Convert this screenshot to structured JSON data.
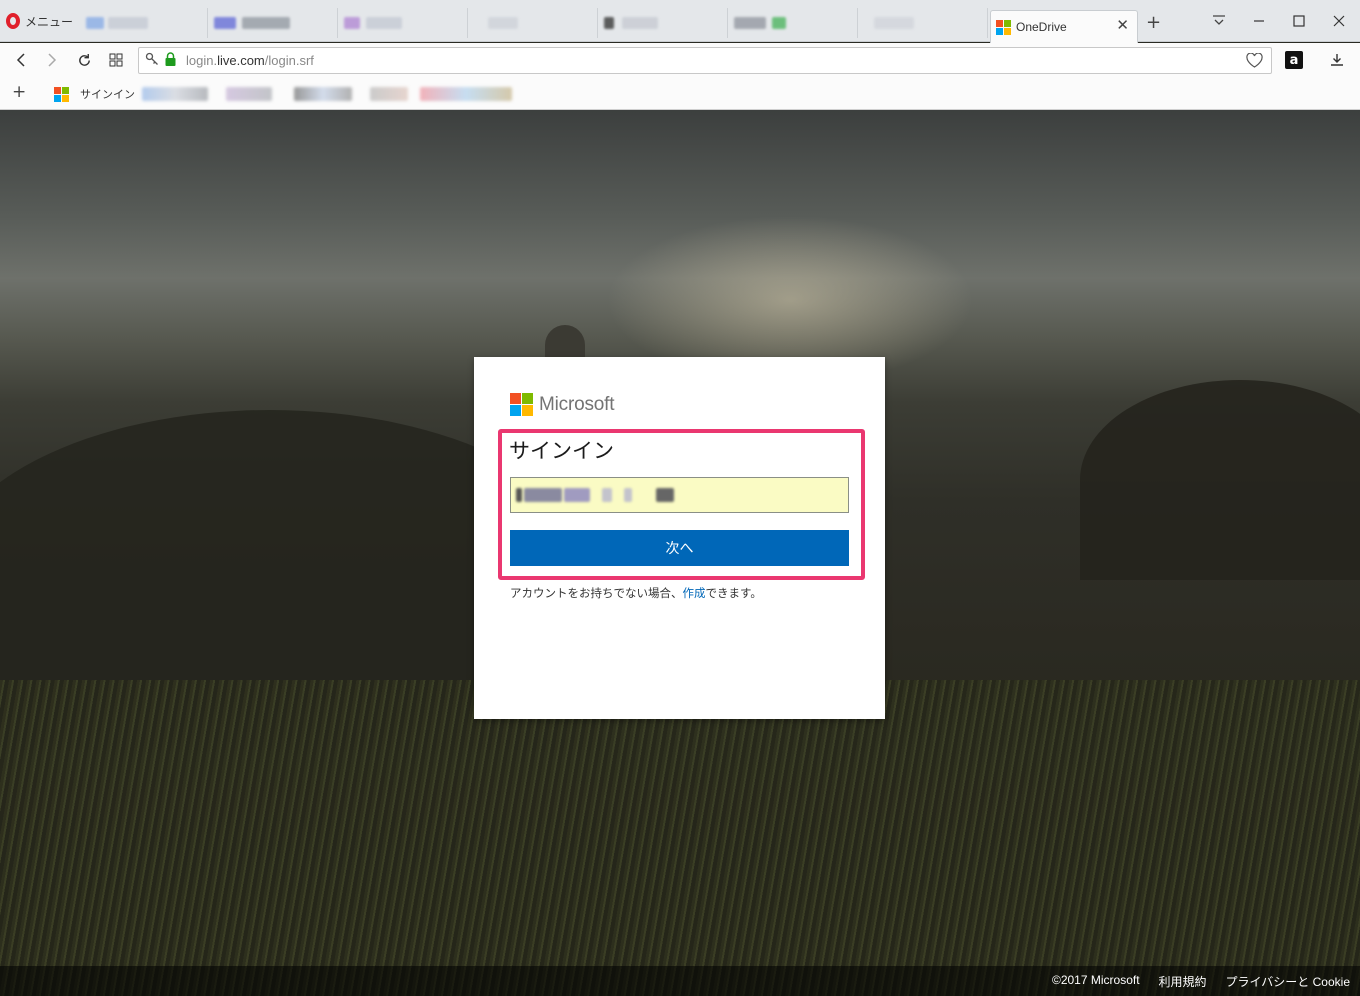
{
  "browser": {
    "menu_label": "メニュー",
    "active_tab": {
      "title": "OneDrive"
    },
    "address": {
      "host": "login.",
      "domain": "live.com",
      "path": "/login.srf"
    },
    "bookmarks": {
      "signin_label": "サインイン"
    }
  },
  "brand": {
    "name": "Microsoft",
    "logo_colors": [
      "#f25022",
      "#7fba00",
      "#00a4ef",
      "#ffb900"
    ]
  },
  "signin": {
    "title": "サインイン",
    "email_value": "",
    "next_label": "次へ",
    "no_account_prefix": "アカウントをお持ちでない場合、",
    "create_link": "作成",
    "no_account_suffix": "できます。"
  },
  "footer": {
    "copyright": "©2017 Microsoft",
    "terms": "利用規約",
    "privacy": "プライバシーと Cookie"
  },
  "colors": {
    "primary_button": "#0067b8",
    "highlight_border": "#ea3770",
    "input_autofill": "#fafbc4"
  }
}
